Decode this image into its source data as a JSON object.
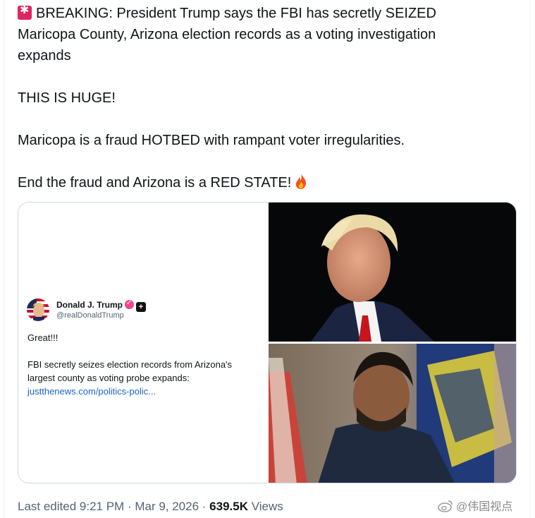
{
  "tweet": {
    "line1": "BREAKING: President Trump says the FBI has secretly SEIZED",
    "line2": "Maricopa County, Arizona election records as a voting investigation",
    "line3": "expands",
    "para2": "THIS IS HUGE!",
    "para3": "Maricopa is a fraud HOTBED with rampant voter irregularities.",
    "para4": "End the fraud and Arizona is a RED STATE!",
    "emoji_start": "siren-emoji",
    "emoji_end": "fire-emoji"
  },
  "embedded_post": {
    "name": "Donald J. Trump",
    "handle": "@realDonaldTrump",
    "line1": "Great!!!",
    "line2": "FBI secretly seizes election records from Arizona's",
    "line3": "largest county as voting probe expands:",
    "link": "justthenews.com/politics-polic..."
  },
  "footer": {
    "edited": "Last edited 9:21 PM",
    "sep1": " · ",
    "date": "Mar 9, 2026",
    "sep2": " · ",
    "views_count": "639.5K",
    "views_label": " Views"
  },
  "watermark": {
    "text": "@伟国视点"
  },
  "colors": {
    "text": "#0f1419",
    "muted": "#536471",
    "link": "#1d64c9",
    "border": "#cfd9de",
    "verified": "#f0488c"
  }
}
